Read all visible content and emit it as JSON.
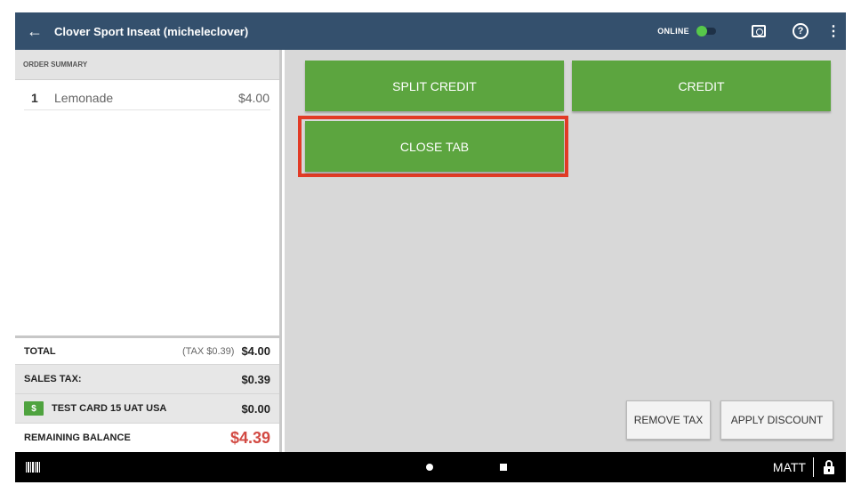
{
  "topbar": {
    "back_icon": "arrow-left-icon",
    "title": "Clover Sport Inseat (micheleclover)",
    "online_label": "ONLINE",
    "online_toggle_on": true,
    "icons": [
      "camera-icon",
      "help-icon",
      "more-vert-icon"
    ]
  },
  "order": {
    "header": "ORDER SUMMARY",
    "items": [
      {
        "qty": "1",
        "name": "Lemonade",
        "price": "$4.00"
      }
    ]
  },
  "totals": {
    "total_label": "TOTAL",
    "tax_note": "(TAX $0.39)",
    "total_value": "$4.00",
    "sales_tax_label": "SALES TAX:",
    "sales_tax_value": "$0.39",
    "card_badge": "$",
    "card_label": "TEST CARD 15 UAT USA",
    "card_value": "$0.00",
    "remaining_label": "REMAINING BALANCE",
    "remaining_value": "$4.39"
  },
  "actions": {
    "split_credit": "SPLIT CREDIT",
    "credit": "CREDIT",
    "close_tab": "CLOSE TAB",
    "remove_tax": "REMOVE TAX",
    "apply_discount": "APPLY DISCOUNT"
  },
  "navbar": {
    "user": "MATT",
    "icons": [
      "barcode-icon",
      "home-icon",
      "recents-icon",
      "lock-icon"
    ]
  },
  "colors": {
    "topbar": "#34506d",
    "green_button": "#5ca53f",
    "highlight": "#e23b26",
    "remaining_balance": "#d24a43"
  }
}
